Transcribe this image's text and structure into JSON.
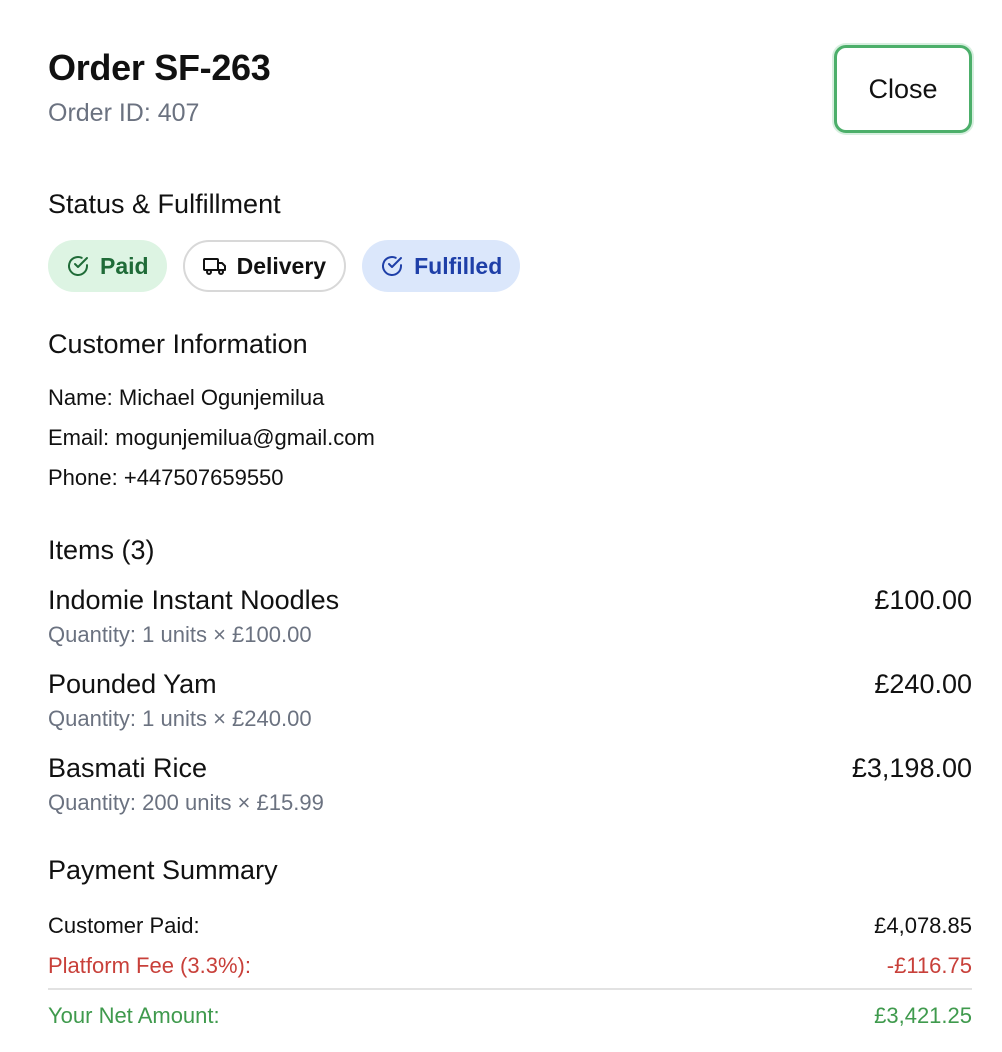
{
  "header": {
    "title": "Order SF-263",
    "subtitle": "Order ID: 407",
    "close_label": "Close"
  },
  "status": {
    "title": "Status & Fulfillment",
    "badges": [
      {
        "label": "Paid",
        "icon": "check-circle-icon",
        "color": "#1f6b38"
      },
      {
        "label": "Delivery",
        "icon": "truck-icon",
        "color": "#111111"
      },
      {
        "label": "Fulfilled",
        "icon": "check-circle-icon",
        "color": "#1e3fa8"
      }
    ]
  },
  "customer": {
    "title": "Customer Information",
    "name_label": "Name:",
    "name": "Michael Ogunjemilua",
    "email_label": "Email:",
    "email": "mogunjemilua@gmail.com",
    "phone_label": "Phone:",
    "phone": "+447507659550"
  },
  "items": {
    "title": "Items (3)",
    "list": [
      {
        "name": "Indomie Instant Noodles",
        "qty": "Quantity: 1 units × £100.00",
        "total": "£100.00"
      },
      {
        "name": "Pounded Yam",
        "qty": "Quantity: 1 units × £240.00",
        "total": "£240.00"
      },
      {
        "name": "Basmati Rice",
        "qty": "Quantity: 200 units × £15.99",
        "total": "£3,198.00"
      }
    ]
  },
  "payment": {
    "title": "Payment Summary",
    "customer_paid_label": "Customer Paid:",
    "customer_paid": "£4,078.85",
    "fee_label": "Platform Fee (3.3%):",
    "fee": "-£116.75",
    "net_label": "Your Net Amount:",
    "net": "£3,421.25"
  },
  "colors": {
    "accent_green": "#4caf6a",
    "fee_red": "#c8403a",
    "net_green": "#3f9a4d"
  }
}
